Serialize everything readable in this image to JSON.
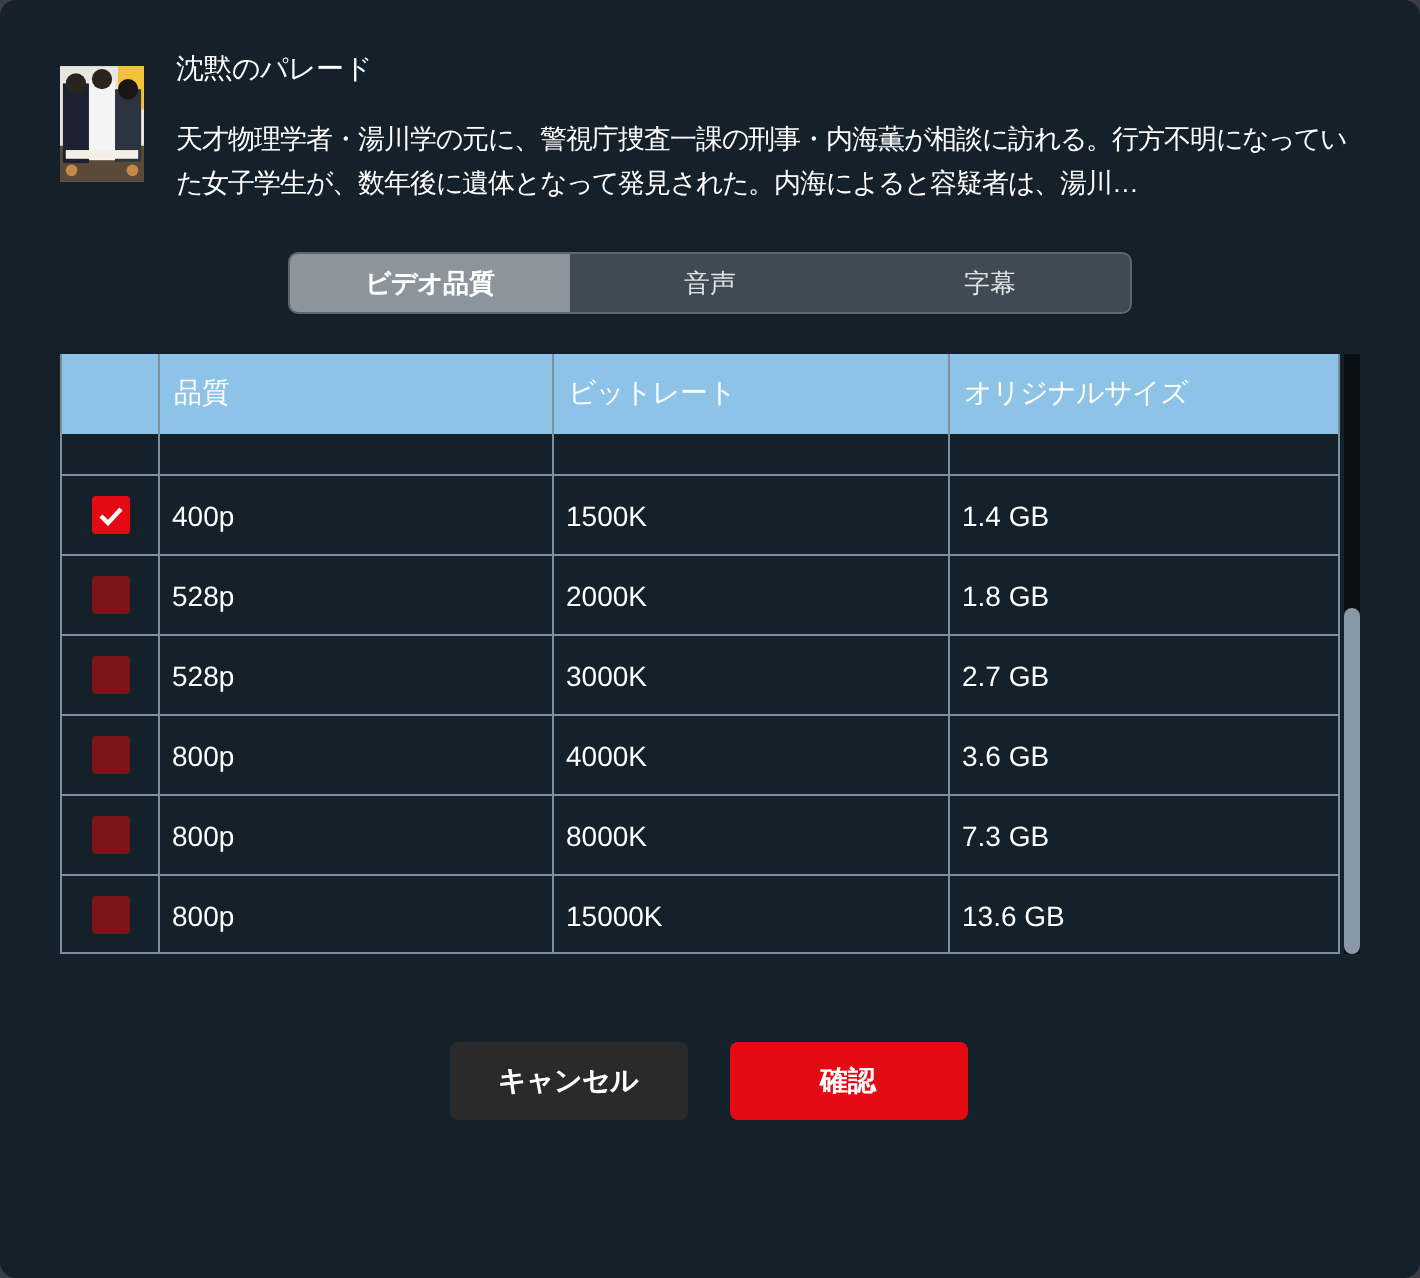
{
  "movie": {
    "title": "沈黙のパレード",
    "description": "天才物理学者・湯川学の元に、警視庁捜査一課の刑事・内海薫が相談に訪れる。行方不明になっていた女子学生が、数年後に遺体となって発見された。内海によると容疑者は、湯川…"
  },
  "tabs": [
    {
      "label": "ビデオ品質",
      "selected": true
    },
    {
      "label": "音声",
      "selected": false
    },
    {
      "label": "字幕",
      "selected": false
    }
  ],
  "table": {
    "columns": [
      "品質",
      "ビットレート",
      "オリジナルサイズ"
    ],
    "rows": [
      {
        "checked": true,
        "cells": [
          "400p",
          "1500K",
          "1.4 GB"
        ]
      },
      {
        "checked": false,
        "cells": [
          "528p",
          "2000K",
          "1.8 GB"
        ]
      },
      {
        "checked": false,
        "cells": [
          "528p",
          "3000K",
          "2.7 GB"
        ]
      },
      {
        "checked": false,
        "cells": [
          "800p",
          "4000K",
          "3.6 GB"
        ]
      },
      {
        "checked": false,
        "cells": [
          "800p",
          "8000K",
          "7.3 GB"
        ]
      },
      {
        "checked": false,
        "cells": [
          "800p",
          "15000K",
          "13.6 GB"
        ]
      }
    ]
  },
  "buttons": [
    {
      "kind": "cancel",
      "label": "キャンセル"
    },
    {
      "kind": "confirm",
      "label": "確認"
    }
  ]
}
